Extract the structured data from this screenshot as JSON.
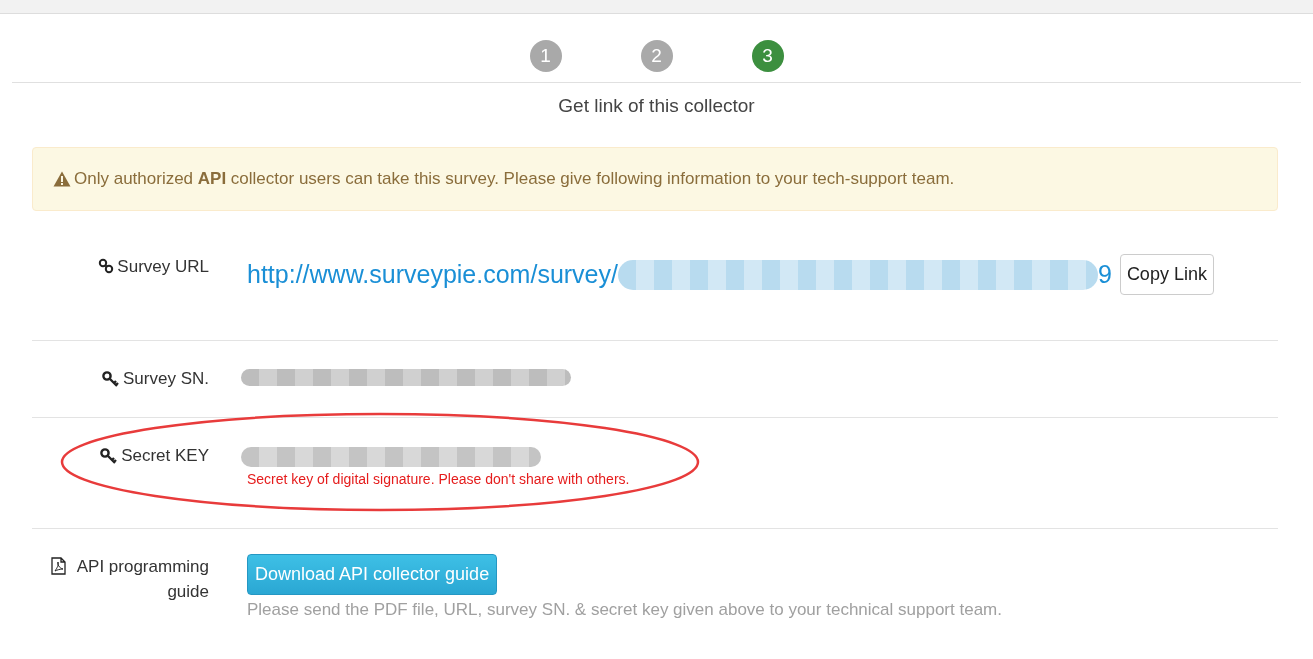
{
  "steps": [
    {
      "label": "1",
      "selected": false
    },
    {
      "label": "2",
      "selected": false
    },
    {
      "label": "3",
      "selected": true
    }
  ],
  "title": "Get link of this collector",
  "alert": {
    "text": "Only authorized **API** collector users can take this survey. Please give following information to your tech-support team."
  },
  "rows": [
    {
      "kind": "url",
      "label": "Survey URL",
      "url_start": "http://www.surveypie.com/survey/",
      "url_end": "9",
      "button": "Copy Link"
    },
    {
      "kind": "redacted",
      "label": "Survey SN."
    },
    {
      "kind": "secret",
      "label": "Secret KEY",
      "note": "Secret key of digital signature. Please don't share with others.",
      "circled": true
    },
    {
      "kind": "download",
      "label": "API programming guide",
      "button": "Download API collector guide",
      "help": "Please send the PDF file, URL, survey SN. & secret key given above to your technical support team."
    }
  ]
}
